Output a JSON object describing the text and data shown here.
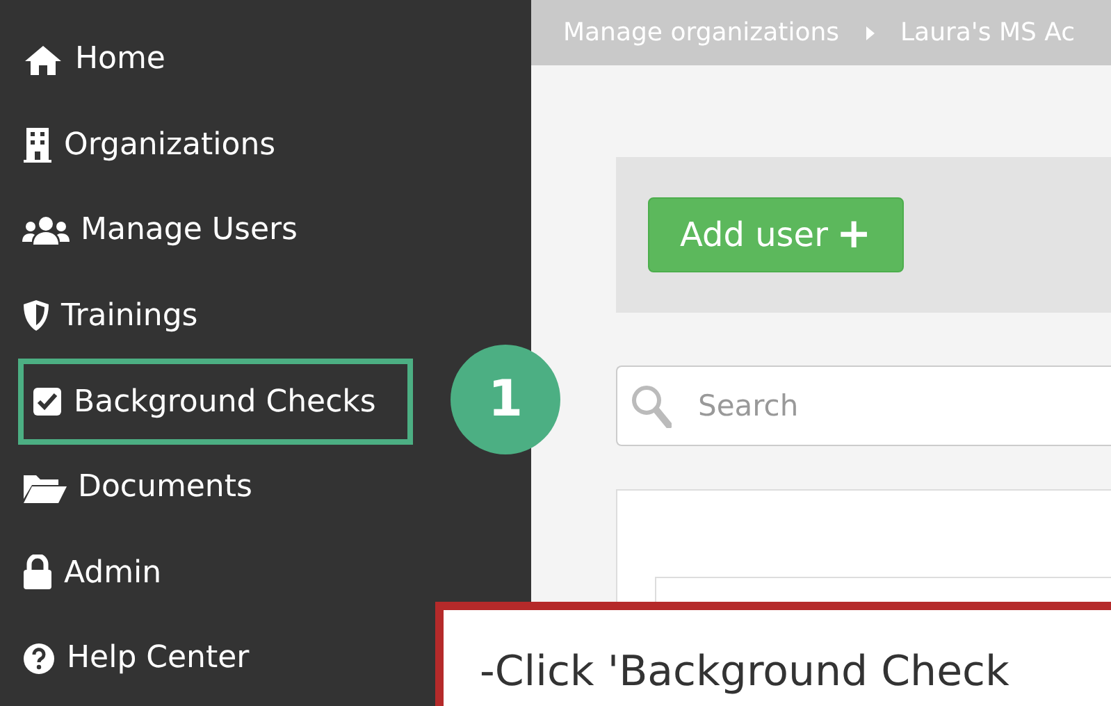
{
  "sidebar": {
    "items": [
      {
        "label": "Home",
        "highlighted": false
      },
      {
        "label": "Organizations",
        "highlighted": false
      },
      {
        "label": "Manage Users",
        "highlighted": false
      },
      {
        "label": "Trainings",
        "highlighted": false
      },
      {
        "label": "Background Checks",
        "highlighted": true
      },
      {
        "label": "Documents",
        "highlighted": false
      },
      {
        "label": "Admin",
        "highlighted": false
      },
      {
        "label": "Help Center",
        "highlighted": false
      }
    ]
  },
  "step_marker": "1",
  "breadcrumb": [
    "Manage organizations",
    "Laura's MS Ac"
  ],
  "add_user_button": {
    "label": "Add user",
    "icon": "+"
  },
  "search": {
    "placeholder": "Search"
  },
  "callout": "-Click 'Background Check"
}
